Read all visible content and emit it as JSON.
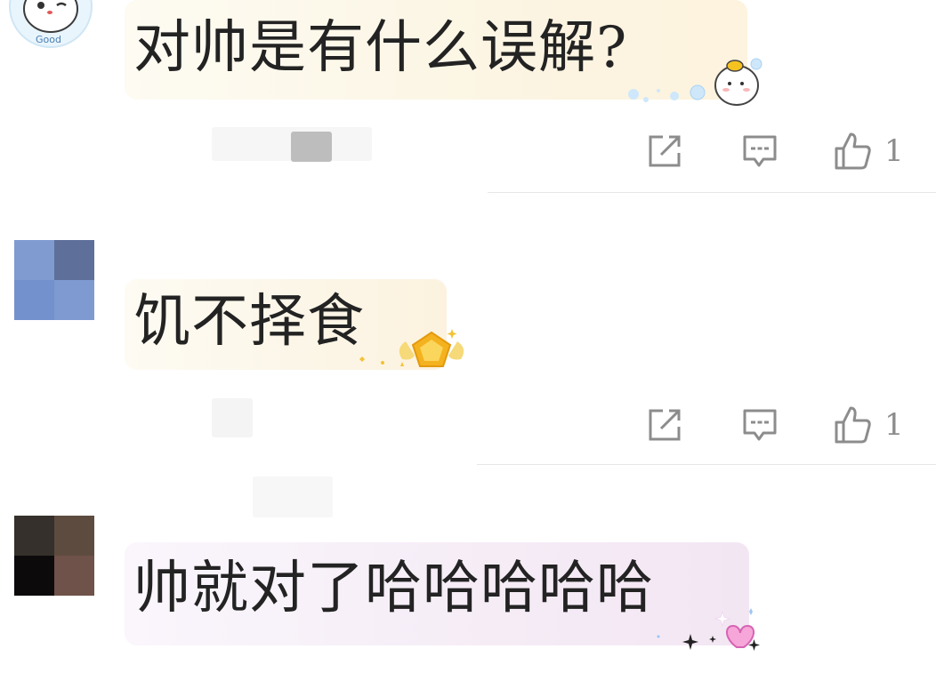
{
  "comments": [
    {
      "text": "对帅是有什么误解?",
      "avatar_text": "Good",
      "like_count": "1",
      "bubble_theme": "warm-yellow",
      "sticker": "chick-with-bubbles"
    },
    {
      "text": "饥不择食",
      "like_count": "1",
      "bubble_theme": "warm-yellow",
      "sticker": "gold-pentagon-medal"
    },
    {
      "text": "帅就对了哈哈哈哈哈",
      "bubble_theme": "pink-purple",
      "sticker": "pink-heart-sparkles"
    }
  ],
  "icons": {
    "share": "share-icon",
    "reply": "comment-icon",
    "like": "thumbs-up-icon"
  },
  "colors": {
    "icon_gray": "#8c8c8c",
    "divider": "#e6e6e6",
    "bubble_yellow": "#fdf6e3",
    "bubble_pink": "#f7eef7"
  }
}
